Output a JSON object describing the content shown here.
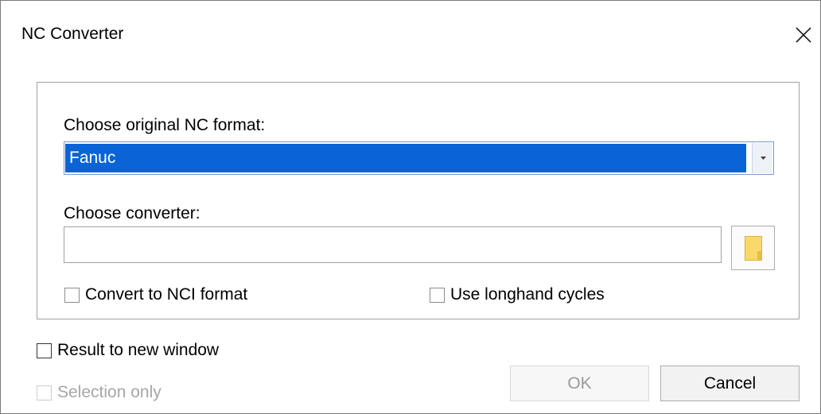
{
  "window": {
    "title": "NC Converter",
    "close_icon": "close-icon"
  },
  "group": {
    "format_label": "Choose original NC format:",
    "format_selected": "Fanuc",
    "converter_label": "Choose converter:",
    "converter_value": "",
    "browse_icon": "folder-icon",
    "convert_nci_label": "Convert to NCI format",
    "convert_nci_checked": false,
    "longhand_label": "Use longhand cycles",
    "longhand_checked": false
  },
  "options": {
    "result_new_window_label": "Result to new window",
    "result_new_window_checked": false,
    "selection_only_label": "Selection only",
    "selection_only_checked": false,
    "selection_only_enabled": false
  },
  "buttons": {
    "ok_label": "OK",
    "ok_enabled": false,
    "cancel_label": "Cancel"
  },
  "colors": {
    "selection_highlight": "#0a64d6",
    "folder_icon": "#fad96b",
    "disabled_text": "#a6a6a6"
  }
}
